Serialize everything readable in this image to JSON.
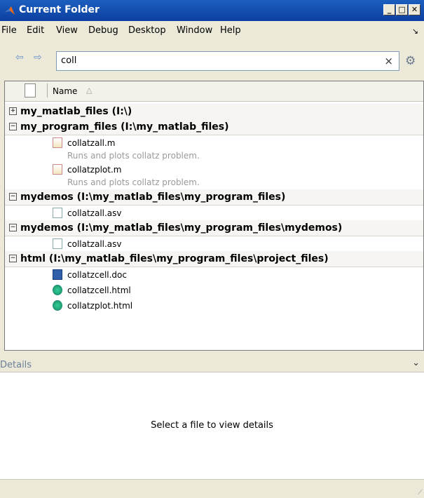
{
  "window": {
    "title": "Current Folder"
  },
  "menu": [
    "File",
    "Edit",
    "View",
    "Debug",
    "Desktop",
    "Window",
    "Help"
  ],
  "address": {
    "value": "coll"
  },
  "columns": {
    "name": "Name"
  },
  "groups": [
    {
      "label": "my_matlab_files (I:\\)",
      "expanded": false,
      "files": []
    },
    {
      "label": "my_program_files (I:\\my_matlab_files)",
      "expanded": true,
      "files": [
        {
          "name": "collatzall.m",
          "icon": "m-file-icon",
          "desc": "Runs and plots collatz problem."
        },
        {
          "name": "collatzplot.m",
          "icon": "m-file-icon",
          "desc": "Runs and plots collatz problem."
        }
      ]
    },
    {
      "label": "mydemos (I:\\my_matlab_files\\my_program_files)",
      "expanded": true,
      "files": [
        {
          "name": "collatzall.asv",
          "icon": "asv-file-icon"
        }
      ]
    },
    {
      "label": "mydemos (I:\\my_matlab_files\\my_program_files\\mydemos)",
      "expanded": true,
      "files": [
        {
          "name": "collatzall.asv",
          "icon": "asv-file-icon"
        }
      ]
    },
    {
      "label": "html (I:\\my_matlab_files\\my_program_files\\project_files)",
      "expanded": true,
      "files": [
        {
          "name": "collatzcell.doc",
          "icon": "doc-file-icon"
        },
        {
          "name": "collatzcell.html",
          "icon": "html-file-icon"
        },
        {
          "name": "collatzplot.html",
          "icon": "html-file-icon"
        }
      ]
    }
  ],
  "details": {
    "label": "Details",
    "message": "Select a file to view details"
  }
}
